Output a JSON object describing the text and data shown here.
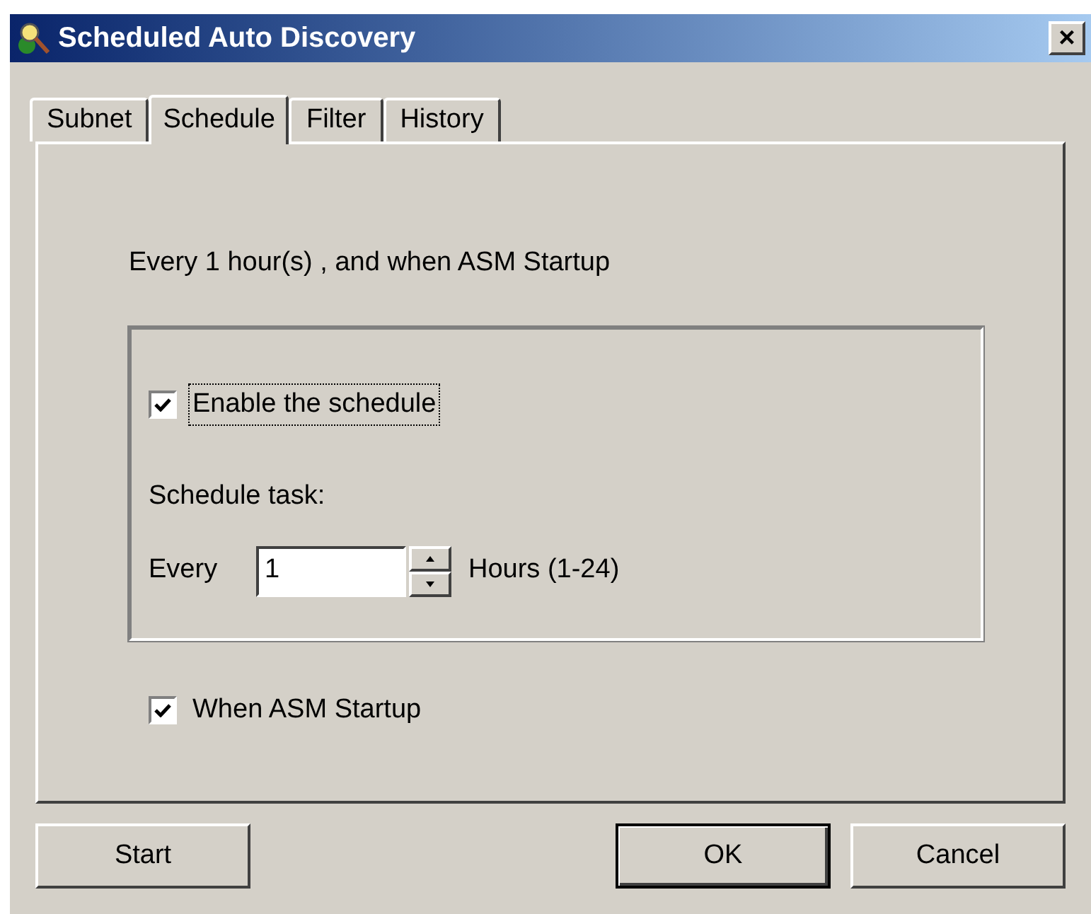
{
  "window": {
    "title": "Scheduled Auto Discovery",
    "close": "×"
  },
  "tabs": [
    {
      "label": "Subnet",
      "selected": false
    },
    {
      "label": "Schedule",
      "selected": true
    },
    {
      "label": "Filter",
      "selected": false
    },
    {
      "label": "History",
      "selected": false
    }
  ],
  "summary": "Every 1 hour(s) , and when ASM Startup",
  "enable": {
    "label": "Enable the schedule",
    "checked": true
  },
  "task_label": "Schedule task:",
  "interval": {
    "prefix": "Every",
    "value": "1",
    "suffix": "Hours (1-24)"
  },
  "startup": {
    "label": "When ASM Startup",
    "checked": true
  },
  "buttons": [
    {
      "label": "Start",
      "default": false
    },
    {
      "label": "OK",
      "default": true
    },
    {
      "label": "Cancel",
      "default": false
    }
  ]
}
